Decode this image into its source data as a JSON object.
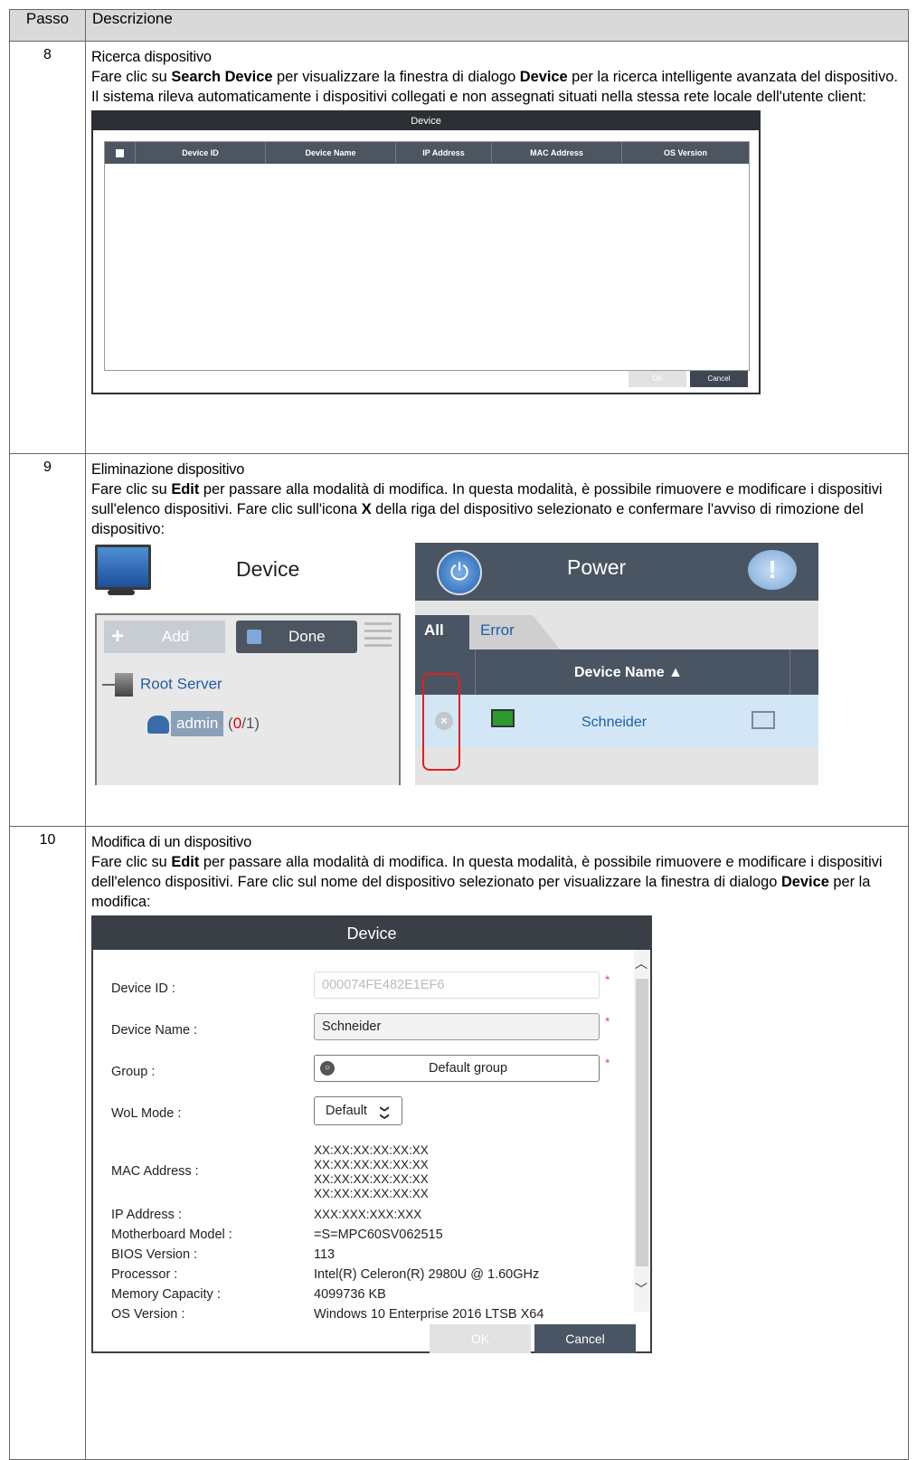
{
  "table": {
    "col_step": "Passo",
    "col_desc": "Descrizione"
  },
  "step8": {
    "number": "8",
    "title": "Ricerca dispositivo",
    "text_a": "Fare clic su ",
    "bold_a": "Search Device",
    "text_b": " per visualizzare la finestra di dialogo ",
    "bold_b": "Device",
    "text_c": " per la ricerca intelligente avanzata del dispositivo. Il sistema rileva automaticamente i dispositivi collegati e non assegnati situati nella stessa rete locale dell'utente client:",
    "dialog": {
      "title": "Device",
      "columns": [
        "Device ID",
        "Device Name",
        "IP Address",
        "MAC Address",
        "OS Version"
      ],
      "ok": "OK",
      "cancel": "Cancel"
    }
  },
  "step9": {
    "number": "9",
    "title": "Eliminazione dispositivo",
    "text_a": "Fare clic su ",
    "bold_a": "Edit",
    "text_b": " per passare alla modalità di modifica. In questa modalità, è possibile rimuovere e modificare i dispositivi sull'elenco dispositivi. Fare clic sull'icona ",
    "bold_b": "X",
    "text_c": " della riga del dispositivo selezionato e confermare l'avviso di rimozione del dispositivo:",
    "panel": {
      "left_title": "Device",
      "add": "Add",
      "done": "Done",
      "root": "Root Server",
      "user": "admin",
      "count_open": "(",
      "count_red": "0",
      "count_rest": "/1)",
      "right_title": "Power",
      "tab_all": "All",
      "tab_error": "Error",
      "col_name": "Device Name ▲",
      "row_name": "Schneider",
      "xmark": "×"
    }
  },
  "step10": {
    "number": "10",
    "title": "Modifica di un dispositivo",
    "text_a": "Fare clic su ",
    "bold_a": "Edit",
    "text_b": " per passare alla modalità di modifica. In questa modalità, è possibile rimuovere e modificare i dispositivi dell'elenco dispositivi. Fare clic sul nome del dispositivo selezionato per visualizzare la finestra di dialogo ",
    "bold_b": "Device",
    "text_c": " per la modifica:",
    "dialog": {
      "title": "Device",
      "device_id_label": "Device ID :",
      "device_id_value": "000074FE482E1EF6",
      "device_name_label": "Device Name :",
      "device_name_value": "Schneider",
      "group_label": "Group :",
      "group_value": "Default group",
      "wol_label": "WoL Mode :",
      "wol_value": "Default",
      "wol_chevron": "❯❯",
      "mac_label": "MAC Address :",
      "mac_values": [
        "XX:XX:XX:XX:XX:XX",
        "XX:XX:XX:XX:XX:XX",
        "XX:XX:XX:XX:XX:XX",
        "XX:XX:XX:XX:XX:XX"
      ],
      "ip_label": "IP Address :",
      "ip_value": "XXX:XXX:XXX:XXX",
      "mb_label": "Motherboard Model :",
      "mb_value": "=S=MPC60SV062515",
      "bios_label": "BIOS Version :",
      "bios_value": "113",
      "cpu_label": "Processor :",
      "cpu_value": "Intel(R) Celeron(R) 2980U @ 1.60GHz",
      "mem_label": "Memory Capacity :",
      "mem_value": "4099736 KB",
      "os_label": "OS Version :",
      "os_value": "Windows 10 Enterprise 2016 LTSB X64",
      "required_mark": "*",
      "ok": "OK",
      "cancel": "Cancel"
    }
  },
  "colors": {
    "header_bg": "#d9d9d9",
    "dark_bar": "#4a5563",
    "link_blue": "#1f5fa8",
    "highlight_red": "#e41e1e"
  }
}
